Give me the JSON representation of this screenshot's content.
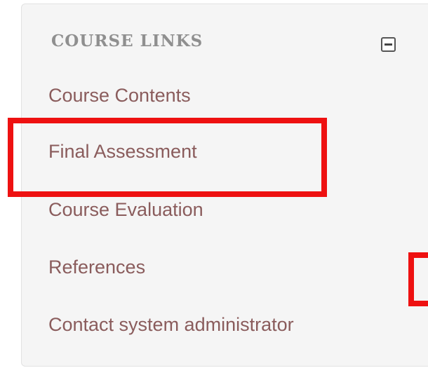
{
  "block": {
    "title": "COURSE LINKS",
    "collapse_icon": "minus-square-icon"
  },
  "links": [
    {
      "label": "Course Contents"
    },
    {
      "label": "Final Assessment"
    },
    {
      "label": "Course Evaluation"
    },
    {
      "label": "References"
    },
    {
      "label": "Contact system administrator"
    }
  ],
  "colors": {
    "panel_background": "#f5f5f5",
    "link_text": "#8a5c5c",
    "title_text": "#8f8f8f",
    "highlight_outline": "#ee1111"
  }
}
